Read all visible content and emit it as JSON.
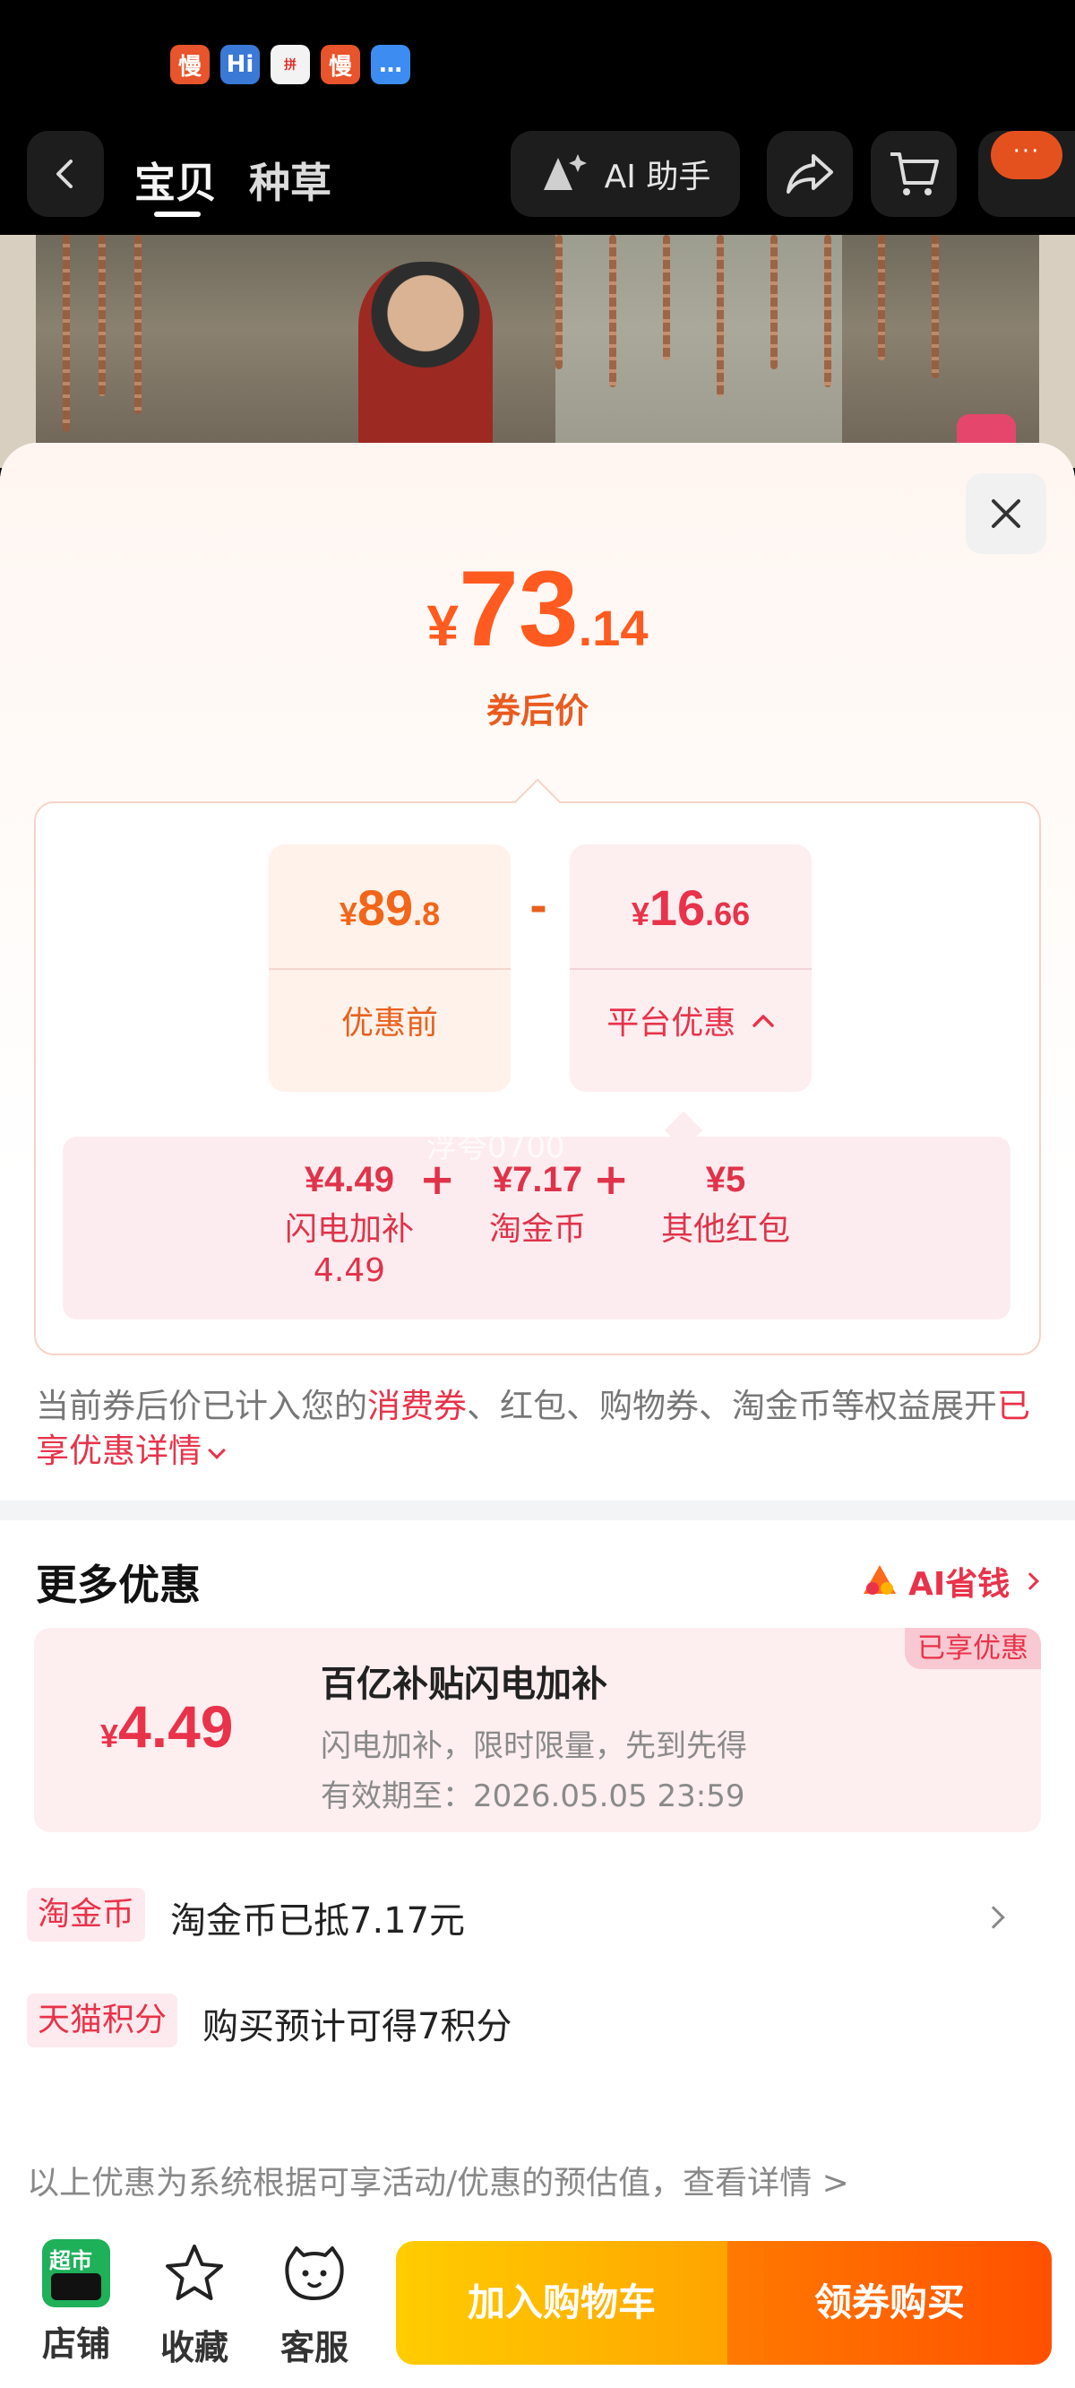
{
  "statusbar": {
    "app_icons": [
      {
        "name": "manbuy-icon",
        "glyph": "慢"
      },
      {
        "name": "kids-app-icon",
        "glyph": "Hi"
      },
      {
        "name": "pdd-icon",
        "glyph": "拼"
      },
      {
        "name": "manbuy-icon-2",
        "glyph": "慢"
      },
      {
        "name": "message-icon",
        "glyph": "…"
      }
    ]
  },
  "navbar": {
    "tab_baobei": "宝贝",
    "tab_zhongcao": "种草",
    "ai_helper_label": "AI 助手",
    "more_badge": "···"
  },
  "sheet": {
    "final_price": {
      "symbol": "¥",
      "integer": "73",
      "decimal": ".14"
    },
    "final_label": "券后价",
    "before": {
      "symbol": "¥",
      "integer": "89",
      "decimal": ".8",
      "label": "优惠前"
    },
    "minus": "-",
    "platform": {
      "symbol": "¥",
      "integer": "16",
      "decimal": ".66",
      "label": "平台优惠"
    },
    "sub_items": [
      {
        "amount": "¥4.49",
        "name": "闪电加补",
        "name2": "4.49"
      },
      {
        "amount": "¥7.17",
        "name": "淘金币"
      },
      {
        "amount": "¥5",
        "name": "其他红包"
      }
    ],
    "plus": "+",
    "watermark": "浮夸0700",
    "note": {
      "part1": "当前券后价已计入您的",
      "hl1": "消费券",
      "part2": "、红包、购物券、淘金币等权益展开",
      "hl2": "已享优惠详情"
    }
  },
  "more": {
    "title": "更多优惠",
    "ai_save": "AI省钱",
    "coupon": {
      "tag": "已享优惠",
      "symbol": "¥",
      "amount": "4.49",
      "title": "百亿补贴闪电加补",
      "desc": "闪电加补，限时限量，先到先得",
      "expiry": "有效期至：2026.05.05 23:59"
    },
    "coin_row": {
      "tag": "淘金币",
      "text": "淘金币已抵7.17元"
    },
    "points_row": {
      "tag": "天猫积分",
      "text": "购买预计可得7积分"
    },
    "disclaimer": "以上优惠为系统根据可享活动/优惠的预估值，查看详情 >"
  },
  "bottom_bar": {
    "store": {
      "label": "店铺",
      "badge": "超市"
    },
    "favorite": {
      "label": "收藏"
    },
    "service": {
      "label": "客服"
    },
    "add_cart": "加入购物车",
    "buy": "领券购买"
  },
  "colors": {
    "accent_orange": "#ff5a1f",
    "accent_red": "#e8334a",
    "cart_yellow": "#ffb800",
    "buy_orange": "#ff5000"
  }
}
